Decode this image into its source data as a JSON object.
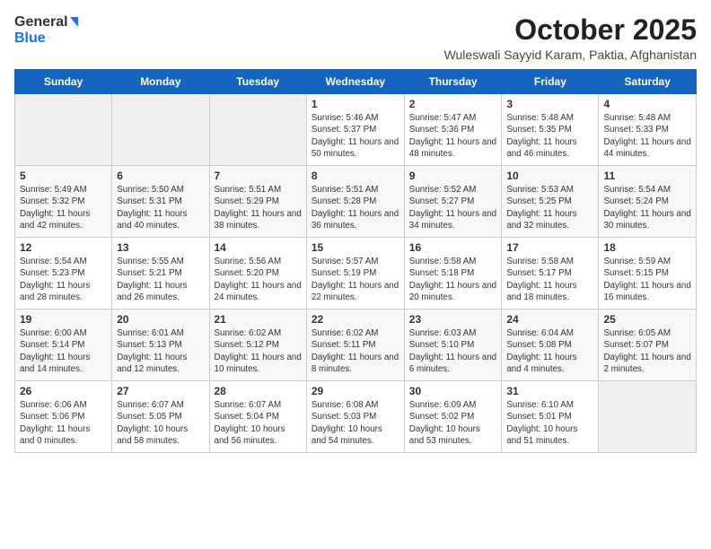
{
  "header": {
    "logo_general": "General",
    "logo_blue": "Blue",
    "title": "October 2025",
    "subtitle": "Wuleswali Sayyid Karam, Paktia, Afghanistan"
  },
  "days_of_week": [
    "Sunday",
    "Monday",
    "Tuesday",
    "Wednesday",
    "Thursday",
    "Friday",
    "Saturday"
  ],
  "weeks": [
    [
      {
        "day": "",
        "info": ""
      },
      {
        "day": "",
        "info": ""
      },
      {
        "day": "",
        "info": ""
      },
      {
        "day": "1",
        "info": "Sunrise: 5:46 AM\nSunset: 5:37 PM\nDaylight: 11 hours\nand 50 minutes."
      },
      {
        "day": "2",
        "info": "Sunrise: 5:47 AM\nSunset: 5:36 PM\nDaylight: 11 hours\nand 48 minutes."
      },
      {
        "day": "3",
        "info": "Sunrise: 5:48 AM\nSunset: 5:35 PM\nDaylight: 11 hours\nand 46 minutes."
      },
      {
        "day": "4",
        "info": "Sunrise: 5:48 AM\nSunset: 5:33 PM\nDaylight: 11 hours\nand 44 minutes."
      }
    ],
    [
      {
        "day": "5",
        "info": "Sunrise: 5:49 AM\nSunset: 5:32 PM\nDaylight: 11 hours\nand 42 minutes."
      },
      {
        "day": "6",
        "info": "Sunrise: 5:50 AM\nSunset: 5:31 PM\nDaylight: 11 hours\nand 40 minutes."
      },
      {
        "day": "7",
        "info": "Sunrise: 5:51 AM\nSunset: 5:29 PM\nDaylight: 11 hours\nand 38 minutes."
      },
      {
        "day": "8",
        "info": "Sunrise: 5:51 AM\nSunset: 5:28 PM\nDaylight: 11 hours\nand 36 minutes."
      },
      {
        "day": "9",
        "info": "Sunrise: 5:52 AM\nSunset: 5:27 PM\nDaylight: 11 hours\nand 34 minutes."
      },
      {
        "day": "10",
        "info": "Sunrise: 5:53 AM\nSunset: 5:25 PM\nDaylight: 11 hours\nand 32 minutes."
      },
      {
        "day": "11",
        "info": "Sunrise: 5:54 AM\nSunset: 5:24 PM\nDaylight: 11 hours\nand 30 minutes."
      }
    ],
    [
      {
        "day": "12",
        "info": "Sunrise: 5:54 AM\nSunset: 5:23 PM\nDaylight: 11 hours\nand 28 minutes."
      },
      {
        "day": "13",
        "info": "Sunrise: 5:55 AM\nSunset: 5:21 PM\nDaylight: 11 hours\nand 26 minutes."
      },
      {
        "day": "14",
        "info": "Sunrise: 5:56 AM\nSunset: 5:20 PM\nDaylight: 11 hours\nand 24 minutes."
      },
      {
        "day": "15",
        "info": "Sunrise: 5:57 AM\nSunset: 5:19 PM\nDaylight: 11 hours\nand 22 minutes."
      },
      {
        "day": "16",
        "info": "Sunrise: 5:58 AM\nSunset: 5:18 PM\nDaylight: 11 hours\nand 20 minutes."
      },
      {
        "day": "17",
        "info": "Sunrise: 5:58 AM\nSunset: 5:17 PM\nDaylight: 11 hours\nand 18 minutes."
      },
      {
        "day": "18",
        "info": "Sunrise: 5:59 AM\nSunset: 5:15 PM\nDaylight: 11 hours\nand 16 minutes."
      }
    ],
    [
      {
        "day": "19",
        "info": "Sunrise: 6:00 AM\nSunset: 5:14 PM\nDaylight: 11 hours\nand 14 minutes."
      },
      {
        "day": "20",
        "info": "Sunrise: 6:01 AM\nSunset: 5:13 PM\nDaylight: 11 hours\nand 12 minutes."
      },
      {
        "day": "21",
        "info": "Sunrise: 6:02 AM\nSunset: 5:12 PM\nDaylight: 11 hours\nand 10 minutes."
      },
      {
        "day": "22",
        "info": "Sunrise: 6:02 AM\nSunset: 5:11 PM\nDaylight: 11 hours\nand 8 minutes."
      },
      {
        "day": "23",
        "info": "Sunrise: 6:03 AM\nSunset: 5:10 PM\nDaylight: 11 hours\nand 6 minutes."
      },
      {
        "day": "24",
        "info": "Sunrise: 6:04 AM\nSunset: 5:08 PM\nDaylight: 11 hours\nand 4 minutes."
      },
      {
        "day": "25",
        "info": "Sunrise: 6:05 AM\nSunset: 5:07 PM\nDaylight: 11 hours\nand 2 minutes."
      }
    ],
    [
      {
        "day": "26",
        "info": "Sunrise: 6:06 AM\nSunset: 5:06 PM\nDaylight: 11 hours\nand 0 minutes."
      },
      {
        "day": "27",
        "info": "Sunrise: 6:07 AM\nSunset: 5:05 PM\nDaylight: 10 hours\nand 58 minutes."
      },
      {
        "day": "28",
        "info": "Sunrise: 6:07 AM\nSunset: 5:04 PM\nDaylight: 10 hours\nand 56 minutes."
      },
      {
        "day": "29",
        "info": "Sunrise: 6:08 AM\nSunset: 5:03 PM\nDaylight: 10 hours\nand 54 minutes."
      },
      {
        "day": "30",
        "info": "Sunrise: 6:09 AM\nSunset: 5:02 PM\nDaylight: 10 hours\nand 53 minutes."
      },
      {
        "day": "31",
        "info": "Sunrise: 6:10 AM\nSunset: 5:01 PM\nDaylight: 10 hours\nand 51 minutes."
      },
      {
        "day": "",
        "info": ""
      }
    ]
  ]
}
